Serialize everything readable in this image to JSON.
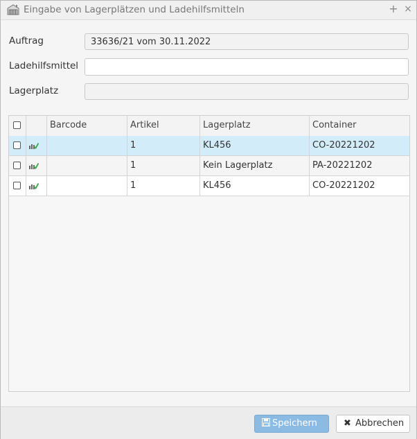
{
  "window": {
    "title": "Eingabe von Lagerplätzen und Ladehilfsmitteln",
    "icon": "warehouse-icon",
    "maximize_glyph": "+",
    "close_glyph": "×"
  },
  "form": {
    "auftrag_label": "Auftrag",
    "auftrag_value": "33636/21 vom 30.11.2022",
    "ladehilfsmittel_label": "Ladehilfsmittel",
    "ladehilfsmittel_value": "",
    "lagerplatz_label": "Lagerplatz",
    "lagerplatz_value": ""
  },
  "grid": {
    "columns": [
      "",
      "",
      "Barcode",
      "Artikel",
      "Lagerplatz",
      "Container"
    ],
    "rows": [
      {
        "barcode": "",
        "artikel": "1",
        "lagerplatz": "KL456",
        "container": "CO-20221202",
        "selected": true
      },
      {
        "barcode": "",
        "artikel": "1",
        "lagerplatz": "Kein Lagerplatz",
        "container": "PA-20221202",
        "selected": false
      },
      {
        "barcode": "",
        "artikel": "1",
        "lagerplatz": "KL456",
        "container": "CO-20221202",
        "selected": false
      }
    ]
  },
  "footer": {
    "save_label": "Speichern",
    "save_icon": "floppy-disk-icon",
    "cancel_label": "Abbrechen",
    "cancel_icon": "x-icon"
  },
  "colors": {
    "selected_row": "#d3ecf9",
    "save_button": "#8bbbe3"
  }
}
